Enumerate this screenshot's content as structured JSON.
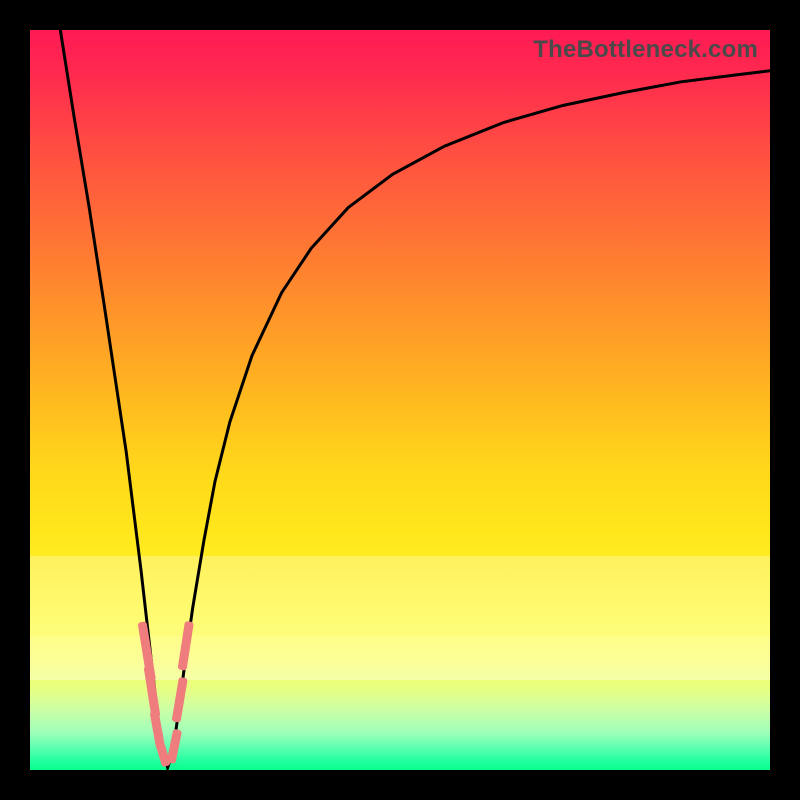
{
  "watermark": "TheBottleneck.com",
  "colors": {
    "frame": "#000000",
    "curve": "#000000",
    "dash": "#ef7d7d"
  },
  "chart_data": {
    "type": "line",
    "title": "",
    "xlabel": "",
    "ylabel": "",
    "xlim": [
      0,
      100
    ],
    "ylim": [
      0,
      100
    ],
    "grid": false,
    "legend": false,
    "note": "Values estimated from pixel positions; no axis ticks or numeric labels are rendered in the image.",
    "curve_xy": [
      [
        4.1,
        100.0
      ],
      [
        6.0,
        88.0
      ],
      [
        8.0,
        76.0
      ],
      [
        10.0,
        63.0
      ],
      [
        11.5,
        53.0
      ],
      [
        13.0,
        43.0
      ],
      [
        14.0,
        35.0
      ],
      [
        15.0,
        27.0
      ],
      [
        15.8,
        20.0
      ],
      [
        16.6,
        13.0
      ],
      [
        17.3,
        7.0
      ],
      [
        18.0,
        2.5
      ],
      [
        18.6,
        0.3
      ],
      [
        19.3,
        2.5
      ],
      [
        20.1,
        8.0
      ],
      [
        21.0,
        15.0
      ],
      [
        22.0,
        22.0
      ],
      [
        23.5,
        31.0
      ],
      [
        25.0,
        39.0
      ],
      [
        27.0,
        47.0
      ],
      [
        30.0,
        56.0
      ],
      [
        34.0,
        64.5
      ],
      [
        38.0,
        70.5
      ],
      [
        43.0,
        76.0
      ],
      [
        49.0,
        80.5
      ],
      [
        56.0,
        84.3
      ],
      [
        64.0,
        87.5
      ],
      [
        72.0,
        89.8
      ],
      [
        80.0,
        91.5
      ],
      [
        88.0,
        93.0
      ],
      [
        96.0,
        94.0
      ],
      [
        100.0,
        94.5
      ]
    ],
    "dashes_xy": [
      [
        15.1,
        20.0,
        16.4,
        12.0
      ],
      [
        15.9,
        14.0,
        17.0,
        7.0
      ],
      [
        16.8,
        8.0,
        17.7,
        3.0
      ],
      [
        17.5,
        3.5,
        18.4,
        0.5
      ],
      [
        19.0,
        1.0,
        19.9,
        5.5
      ],
      [
        19.7,
        6.5,
        20.7,
        12.5
      ],
      [
        20.6,
        13.5,
        21.6,
        20.0
      ]
    ]
  }
}
